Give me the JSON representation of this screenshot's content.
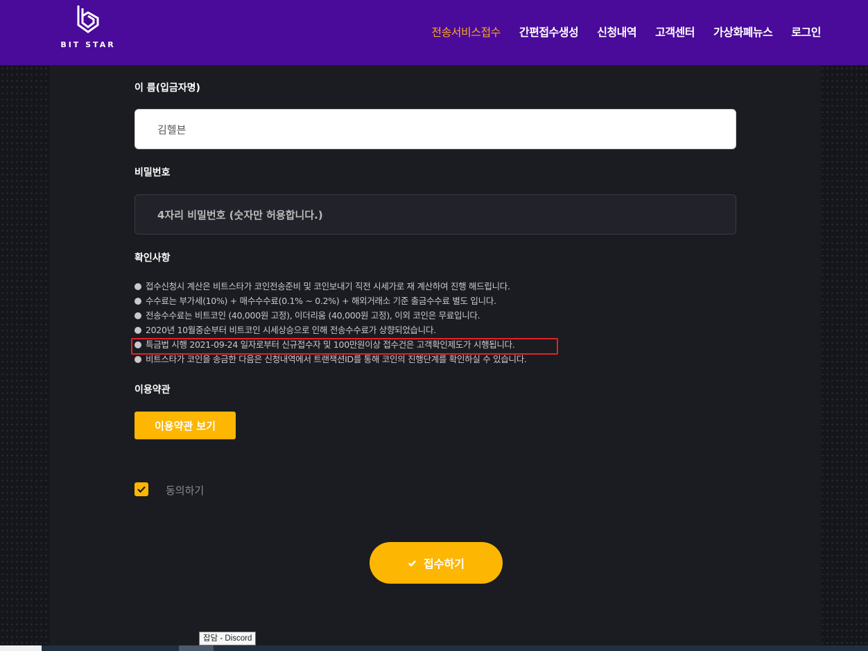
{
  "header": {
    "logo_text": "BIT STAR",
    "nav": [
      {
        "label": "전송서비스접수",
        "active": true
      },
      {
        "label": "간편접수생성",
        "active": false
      },
      {
        "label": "신청내역",
        "active": false
      },
      {
        "label": "고객센터",
        "active": false
      },
      {
        "label": "가상화폐뉴스",
        "active": false
      },
      {
        "label": "로그인",
        "active": false
      }
    ]
  },
  "form": {
    "name_label": "이 름(입금자명)",
    "name_value": "김헬븐",
    "password_label": "비밀번호",
    "password_placeholder": "4자리 비밀번호 (숫자만 허용합니다.)",
    "notice_label": "확인사항",
    "notices": [
      "접수신청시 계산은 비트스타가 코인전송준비 및 코인보내기 직전 시세가로 재 계산하여 진행 해드립니다.",
      "수수료는 부가세(10%) + 매수수수료(0.1% ~ 0.2%) + 해외거래소 기준 출금수수료 별도 입니다.",
      "전송수수료는 비트코인 (40,000원 고정), 이더리움 (40,000원 고정), 이외 코인은 무료입니다.",
      "2020년 10월중순부터 비트코인 시세상승으로 인해 전송수수료가 상향되었습니다.",
      "특금법 시행 2021-09-24 일자로부터 신규접수자 및 100만원이상 접수건은 고객확인제도가 시행됩니다.",
      "비트스타가 코인을 송금한 다음은 신청내역에서 트랜잭션ID를 통해 코인의 진행단계를 확인하실 수 있습니다."
    ],
    "terms_label": "이용약관",
    "terms_button": "이용약관 보기",
    "agree_label": "동의하기",
    "agree_checked": true,
    "submit_label": "접수하기"
  },
  "taskbar": {
    "tooltip": "잡담 - Discord"
  },
  "colors": {
    "header_bg": "#4a0a9a",
    "accent": "#fdb602",
    "active_nav": "#f5a623",
    "highlight_border": "#e0242a"
  }
}
